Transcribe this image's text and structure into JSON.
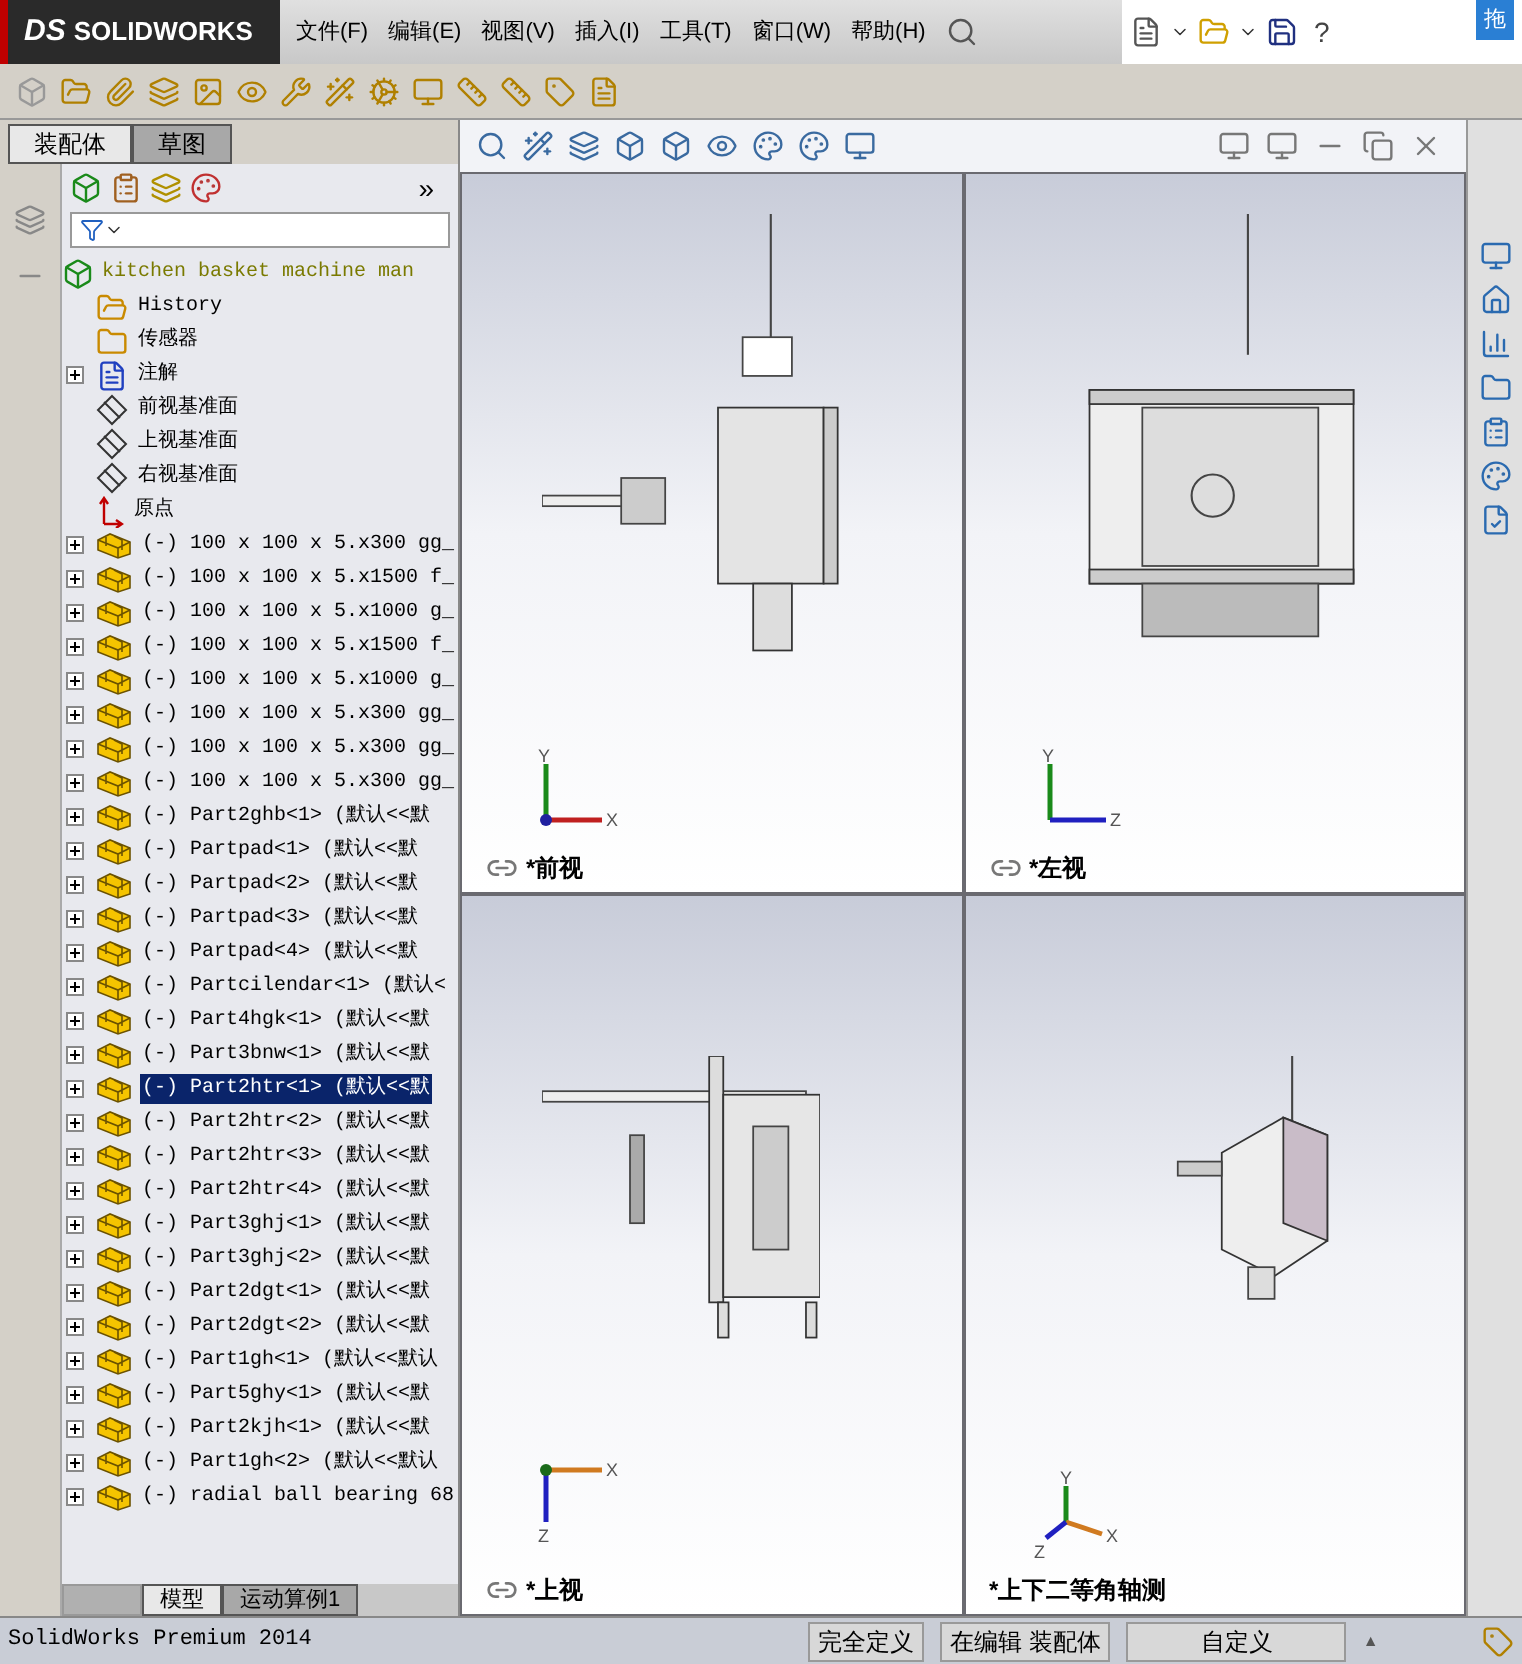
{
  "app": {
    "logo_prefix": "DS",
    "logo": "SOLIDWORKS"
  },
  "menu": [
    "文件(F)",
    "编辑(E)",
    "视图(V)",
    "插入(I)",
    "工具(T)",
    "窗口(W)",
    "帮助(H)"
  ],
  "help_mark": "?",
  "corner_badge": "拖",
  "panel_tabs": [
    {
      "label": "装配体",
      "selected": true
    },
    {
      "label": "草图",
      "selected": false
    }
  ],
  "panel_more": "»",
  "tree": {
    "root": "kitchen basket machine man",
    "items": [
      {
        "kind": "history",
        "label": "History",
        "selected": false
      },
      {
        "kind": "sensor",
        "label": "传感器",
        "selected": false
      },
      {
        "kind": "annotation",
        "label": "注解",
        "expanded": false,
        "selected": false
      },
      {
        "kind": "plane",
        "label": "前视基准面",
        "selected": false
      },
      {
        "kind": "plane",
        "label": "上视基准面",
        "selected": false
      },
      {
        "kind": "plane",
        "label": "右视基准面",
        "selected": false
      },
      {
        "kind": "origin",
        "label": "原点",
        "selected": false
      },
      {
        "kind": "part",
        "label": "(-) 100 x 100 x 5.x300 gg_",
        "expanded": false,
        "selected": false
      },
      {
        "kind": "part",
        "label": "(-) 100 x 100 x 5.x1500 f_",
        "expanded": false,
        "selected": false
      },
      {
        "kind": "part",
        "label": "(-) 100 x 100 x 5.x1000 g_",
        "expanded": false,
        "selected": false
      },
      {
        "kind": "part",
        "label": "(-) 100 x 100 x 5.x1500 f_",
        "expanded": false,
        "selected": false
      },
      {
        "kind": "part",
        "label": "(-) 100 x 100 x 5.x1000 g_",
        "expanded": false,
        "selected": false
      },
      {
        "kind": "part",
        "label": "(-) 100 x 100 x 5.x300 gg_",
        "expanded": false,
        "selected": false
      },
      {
        "kind": "part",
        "label": "(-) 100 x 100 x 5.x300 gg_",
        "expanded": false,
        "selected": false
      },
      {
        "kind": "part",
        "label": "(-) 100 x 100 x 5.x300 gg_",
        "expanded": false,
        "selected": false
      },
      {
        "kind": "part",
        "label": "(-) Part2ghb<1> (默认<<默",
        "expanded": false,
        "selected": false
      },
      {
        "kind": "part",
        "label": "(-) Partpad<1> (默认<<默",
        "expanded": false,
        "selected": false
      },
      {
        "kind": "part",
        "label": "(-) Partpad<2> (默认<<默",
        "expanded": false,
        "selected": false
      },
      {
        "kind": "part",
        "label": "(-) Partpad<3> (默认<<默",
        "expanded": false,
        "selected": false
      },
      {
        "kind": "part",
        "label": "(-) Partpad<4> (默认<<默",
        "expanded": false,
        "selected": false
      },
      {
        "kind": "part",
        "label": "(-) Partcilendar<1> (默认<",
        "expanded": false,
        "selected": false
      },
      {
        "kind": "part",
        "label": "(-) Part4hgk<1> (默认<<默",
        "expanded": false,
        "selected": false
      },
      {
        "kind": "part",
        "label": "(-) Part3bnw<1> (默认<<默",
        "expanded": false,
        "selected": false
      },
      {
        "kind": "part",
        "label": "(-) Part2htr<1> (默认<<默",
        "expanded": false,
        "selected": true
      },
      {
        "kind": "part",
        "label": "(-) Part2htr<2> (默认<<默",
        "expanded": false,
        "selected": false
      },
      {
        "kind": "part",
        "label": "(-) Part2htr<3> (默认<<默",
        "expanded": false,
        "selected": false
      },
      {
        "kind": "part",
        "label": "(-) Part2htr<4> (默认<<默",
        "expanded": false,
        "selected": false
      },
      {
        "kind": "part",
        "label": "(-) Part3ghj<1> (默认<<默",
        "expanded": false,
        "selected": false
      },
      {
        "kind": "part",
        "label": "(-) Part3ghj<2> (默认<<默",
        "expanded": false,
        "selected": false
      },
      {
        "kind": "part",
        "label": "(-) Part2dgt<1> (默认<<默",
        "expanded": false,
        "selected": false
      },
      {
        "kind": "part",
        "label": "(-) Part2dgt<2> (默认<<默",
        "expanded": false,
        "selected": false
      },
      {
        "kind": "part",
        "label": "(-) Part1gh<1> (默认<<默认",
        "expanded": false,
        "selected": false
      },
      {
        "kind": "part",
        "label": "(-) Part5ghy<1> (默认<<默",
        "expanded": false,
        "selected": false
      },
      {
        "kind": "part",
        "label": "(-) Part2kjh<1> (默认<<默",
        "expanded": false,
        "selected": false
      },
      {
        "kind": "part",
        "label": "(-) Part1gh<2> (默认<<默认",
        "expanded": false,
        "selected": false
      },
      {
        "kind": "part",
        "label": "(-) radial ball bearing 68",
        "expanded": false,
        "selected": false
      }
    ]
  },
  "bottom_tabs": [
    {
      "label": "模型",
      "selected": true
    },
    {
      "label": "运动算例1",
      "selected": false
    }
  ],
  "viewports": [
    {
      "kind": "front",
      "label": "*前视",
      "linked": true,
      "axes": [
        "Y",
        "X"
      ]
    },
    {
      "kind": "left",
      "label": "*左视",
      "linked": true,
      "axes": [
        "Y",
        "Z"
      ]
    },
    {
      "kind": "top",
      "label": "*上视",
      "linked": true,
      "axes": [
        "X",
        "Z"
      ]
    },
    {
      "kind": "iso",
      "label": "*上下二等角轴测",
      "linked": false,
      "axes": [
        "Y",
        "X",
        "Z"
      ]
    }
  ],
  "status_bar": {
    "product": "SolidWorks Premium 2014",
    "fields": [
      "完全定义",
      "在编辑 装配体",
      "自定义"
    ],
    "caret": "▲"
  }
}
